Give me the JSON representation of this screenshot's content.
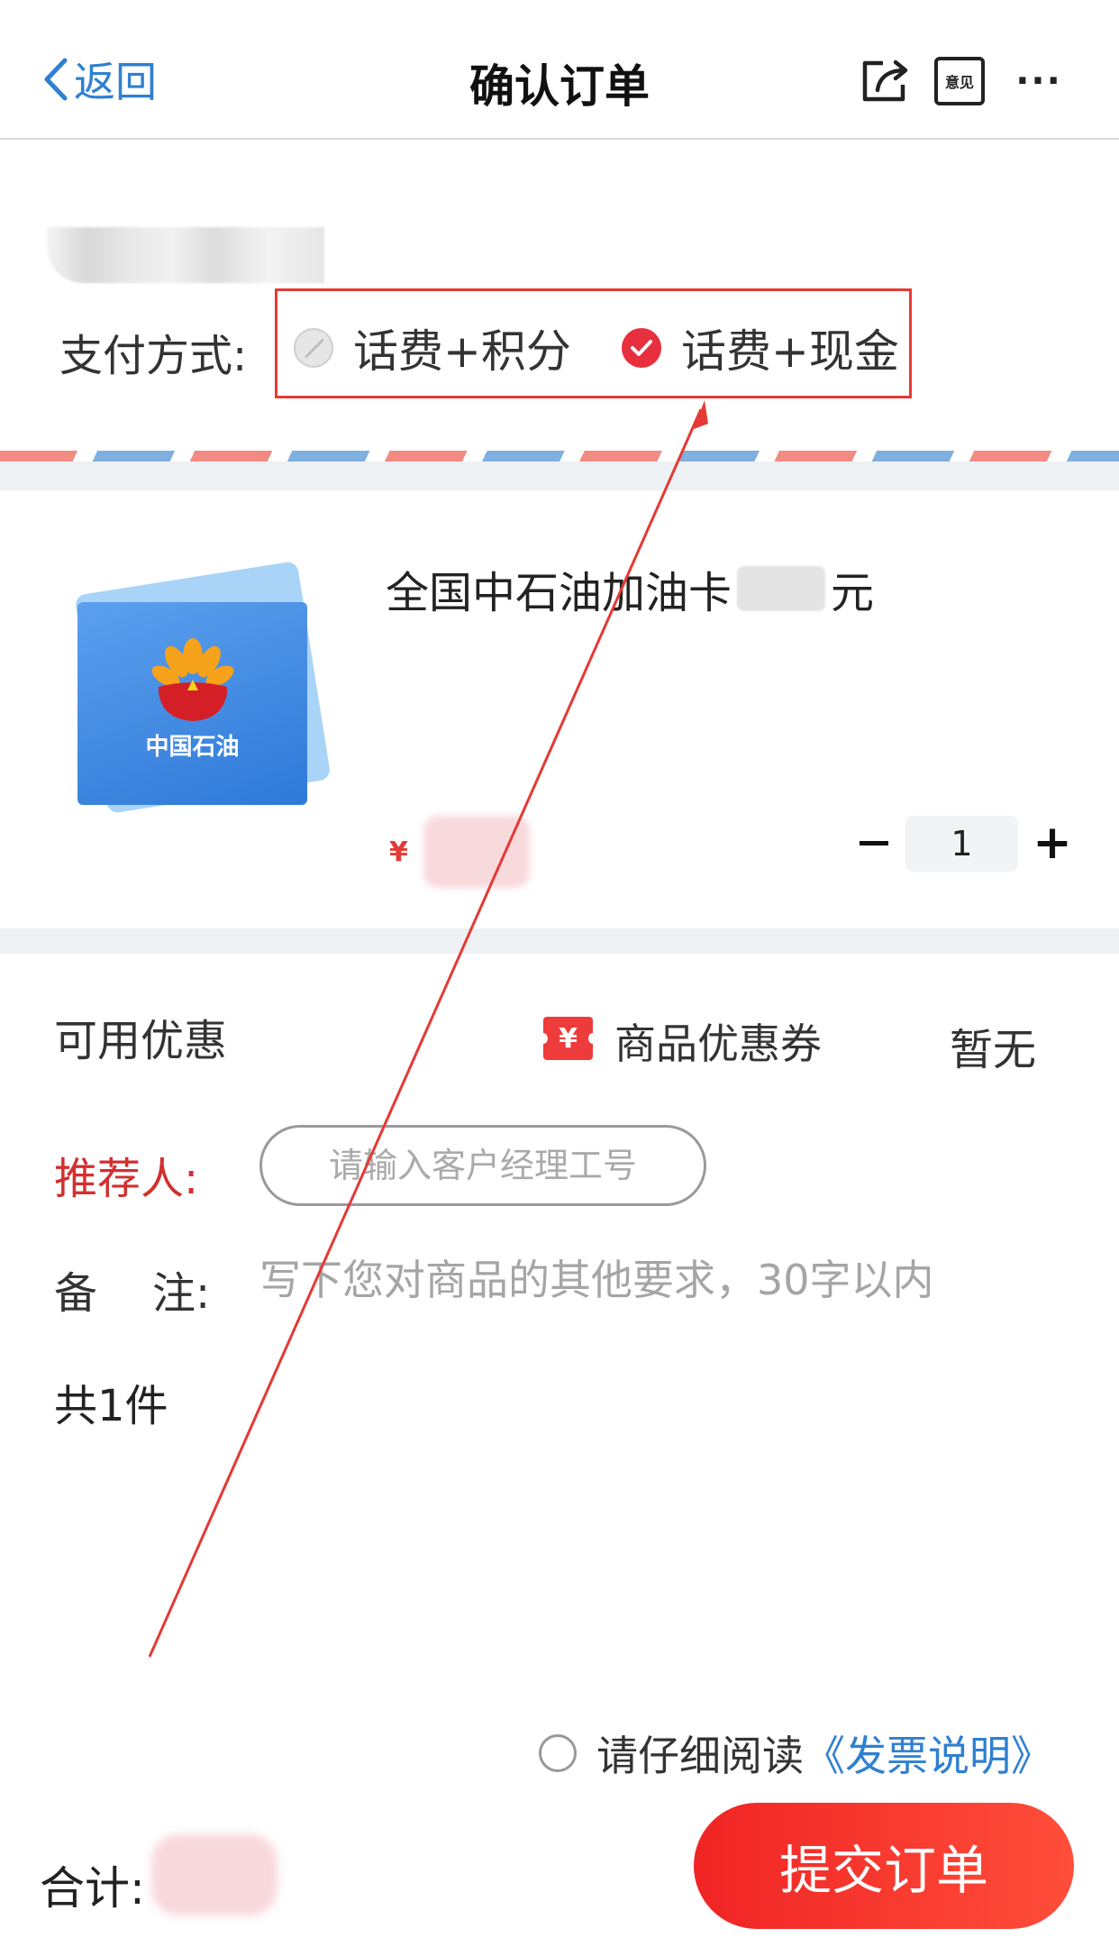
{
  "nav": {
    "back_label": "返回",
    "title": "确认订单",
    "feedback_label": "意见",
    "more_label": "···"
  },
  "payment": {
    "label": "支付方式:",
    "options": [
      {
        "label": "话费+积分",
        "state": "disabled"
      },
      {
        "label": "话费+现金",
        "state": "checked"
      }
    ]
  },
  "product": {
    "brand_text": "中国石油",
    "title_prefix": "全国中石油加油卡",
    "title_suffix": "元",
    "price_symbol": "¥",
    "quantity": "1",
    "minus_label": "−",
    "plus_label": "+"
  },
  "discount": {
    "label": "可用优惠",
    "coupon_icon_text": "¥",
    "coupon_label": "商品优惠券",
    "coupon_value": "暂无"
  },
  "referrer": {
    "label": "推荐人:",
    "placeholder": "请输入客户经理工号"
  },
  "remark": {
    "label": "备    注:",
    "placeholder": "写下您对商品的其他要求，30字以内"
  },
  "count": {
    "text": "共1件"
  },
  "invoice": {
    "prefix": "请仔细阅读",
    "link": "《发票说明》"
  },
  "footer": {
    "total_label": "合计:",
    "submit_label": "提交订单"
  },
  "colors": {
    "accent_blue": "#2f80d1",
    "accent_red": "#e82f3e",
    "submit_gradient_start": "#f02424",
    "submit_gradient_end": "#ff4e3a"
  }
}
